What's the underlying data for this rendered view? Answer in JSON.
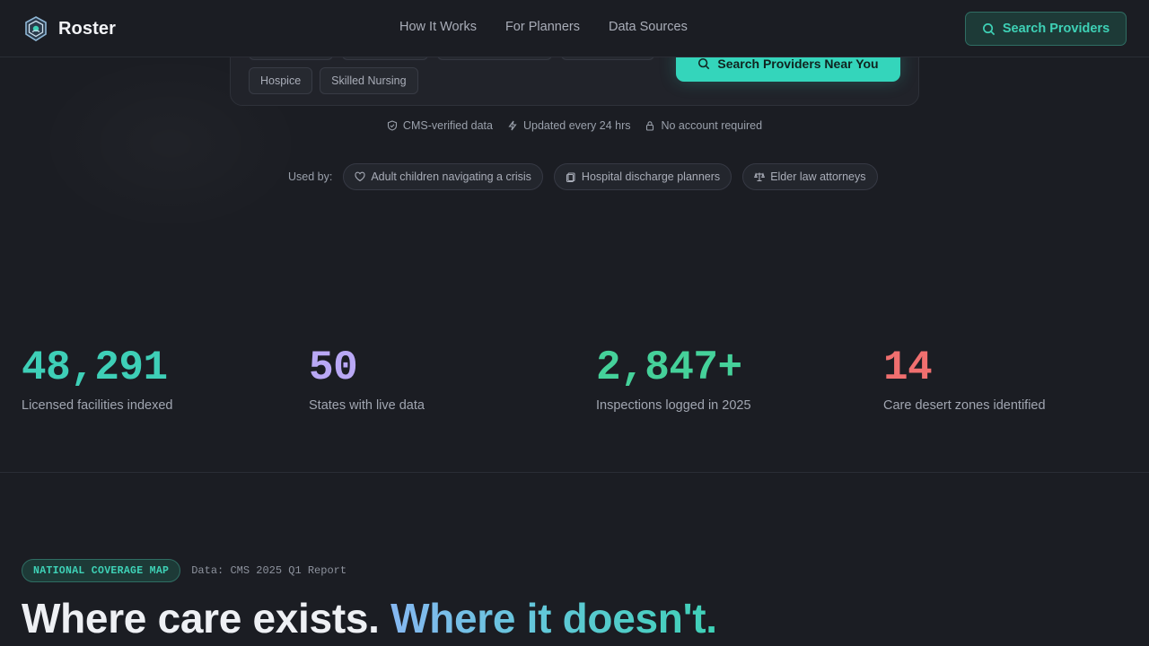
{
  "brand": {
    "name": "Roster"
  },
  "nav": {
    "links": [
      "How It Works",
      "For Planners",
      "Data Sources"
    ],
    "cta_label": "Search Providers"
  },
  "search": {
    "care_types": [
      "Hospice",
      "Skilled Nursing"
    ],
    "button_label": "Search Providers Near You"
  },
  "trust": {
    "items": [
      "CMS-verified data",
      "Updated every 24 hrs",
      "No account required"
    ]
  },
  "used_by": {
    "label": "Used by:",
    "items": [
      "Adult children navigating a crisis",
      "Hospital discharge planners",
      "Elder law attorneys"
    ]
  },
  "stats": [
    {
      "value": "48,291",
      "label": "Licensed facilities indexed",
      "color": "#3ecfb7"
    },
    {
      "value": "50",
      "label": "States with live data",
      "color": "#b9a8f5"
    },
    {
      "value": "2,847+",
      "label": "Inspections logged in 2025",
      "color": "#45d19a"
    },
    {
      "value": "14",
      "label": "Care desert zones identified",
      "color": "#f06f6f"
    }
  ],
  "coverage": {
    "badge": "NATIONAL COVERAGE MAP",
    "source": "Data: CMS 2025 Q1 Report",
    "title_part1": "Where care exists.",
    "title_part2": "Where it doesn't."
  },
  "colors": {
    "accent": "#34d5bb",
    "background": "#1b1d23"
  }
}
